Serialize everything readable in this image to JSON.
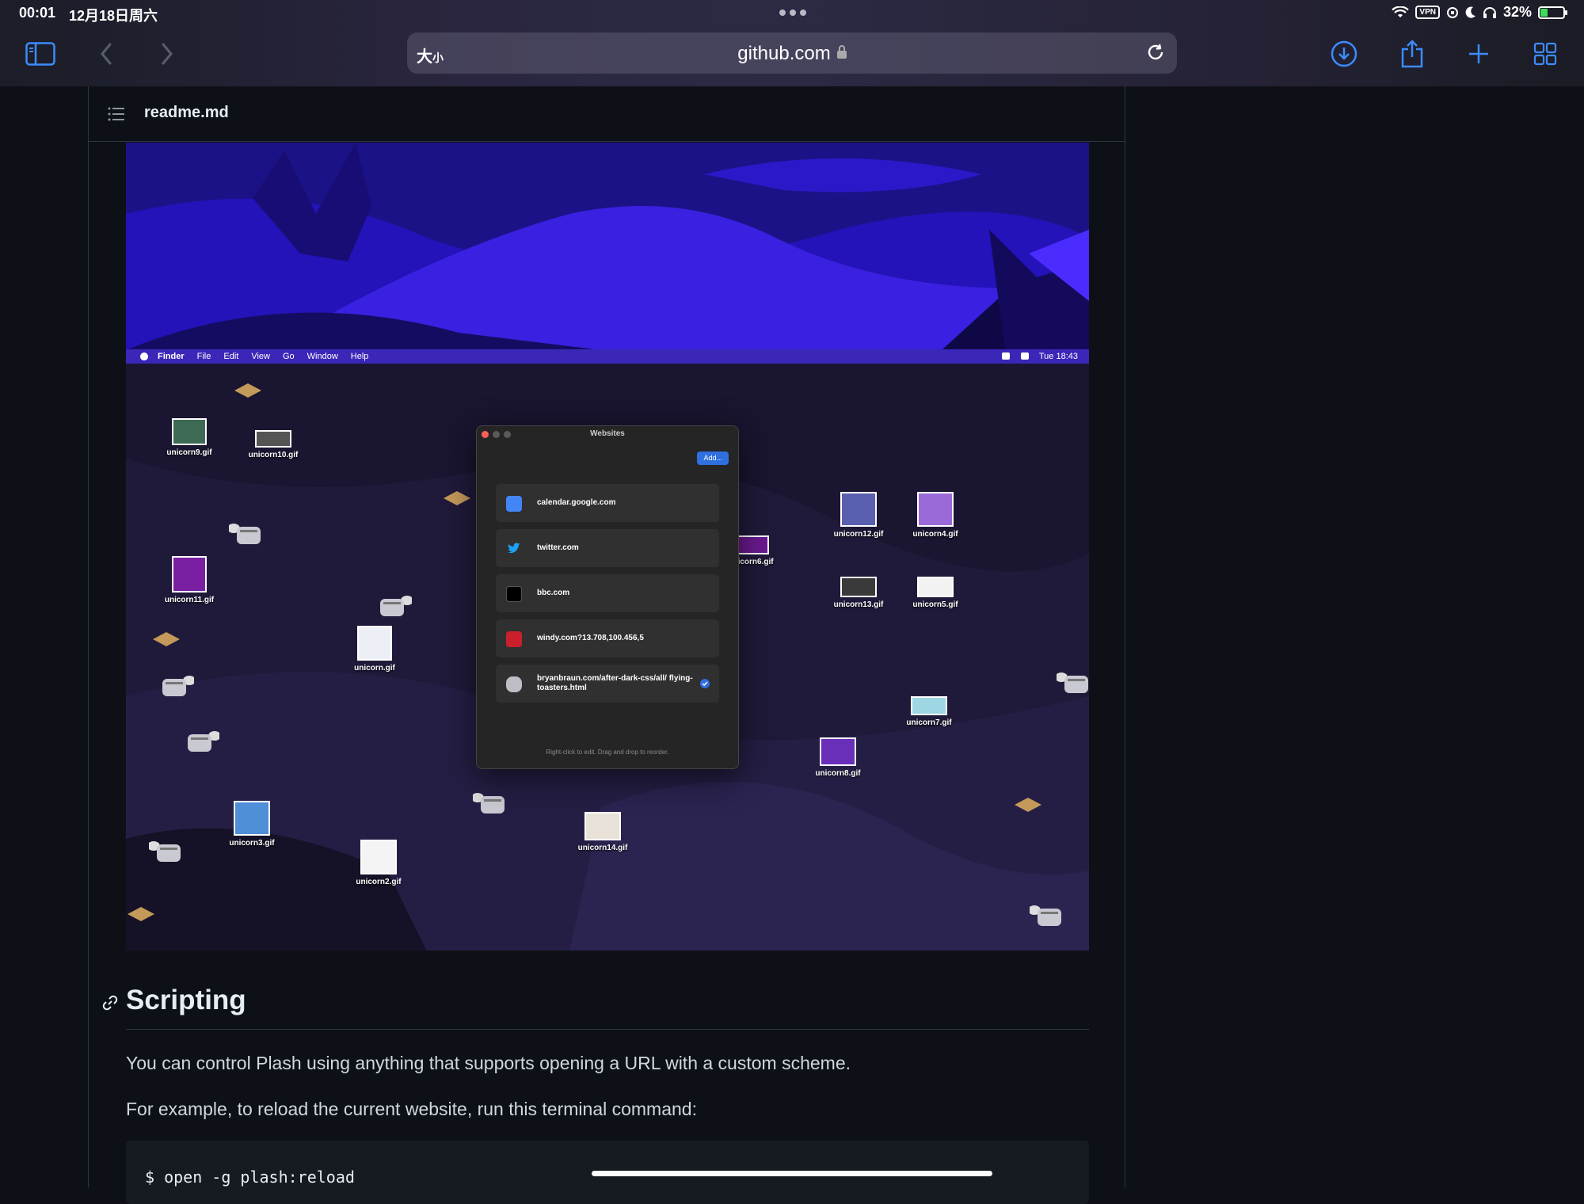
{
  "status_bar": {
    "time": "00:01",
    "date": "12月18日周六",
    "vpn": "VPN",
    "battery": "32%"
  },
  "browser": {
    "text_size_label": "大",
    "text_size_small": "小",
    "url": "github.com",
    "icons": [
      "sidebar-icon",
      "back-icon",
      "forward-icon",
      "reload-icon",
      "download-icon",
      "share-icon",
      "new-tab-icon",
      "tabs-overview-icon"
    ]
  },
  "file": {
    "name": "readme.md"
  },
  "embedded_screenshot": {
    "menubar": {
      "items": [
        "Finder",
        "File",
        "Edit",
        "View",
        "Go",
        "Window",
        "Help"
      ],
      "clock": "Tue 18:43"
    },
    "desktop_icons": [
      "unicorn9.gif",
      "unicorn10.gif",
      "unicorn11.gif",
      "unicorn.gif",
      "unicorn3.gif",
      "unicorn2.gif",
      "unicorn14.gif",
      "unicorn6.gif",
      "unicorn12.gif",
      "unicorn4.gif",
      "unicorn13.gif",
      "unicorn5.gif",
      "unicorn7.gif",
      "unicorn8.gif"
    ],
    "window": {
      "title": "Websites",
      "add_button": "Add...",
      "sites": [
        "calendar.google.com",
        "twitter.com",
        "bbc.com",
        "windy.com?13.708,100.456,5",
        "bryanbraun.com/after-dark-css/all/ flying-toasters.html"
      ],
      "hint": "Right-click to edit. Drag and drop to reorder."
    }
  },
  "content": {
    "heading": "Scripting",
    "para1": "You can control Plash using anything that supports opening a URL with a custom scheme.",
    "para2": "For example, to reload the current website, run this terminal command:",
    "code": "$ open -g plash:reload"
  },
  "colors": {
    "accent": "#0a84ff",
    "page_bg": "#0d1117",
    "menubar": "#3a27b8"
  }
}
